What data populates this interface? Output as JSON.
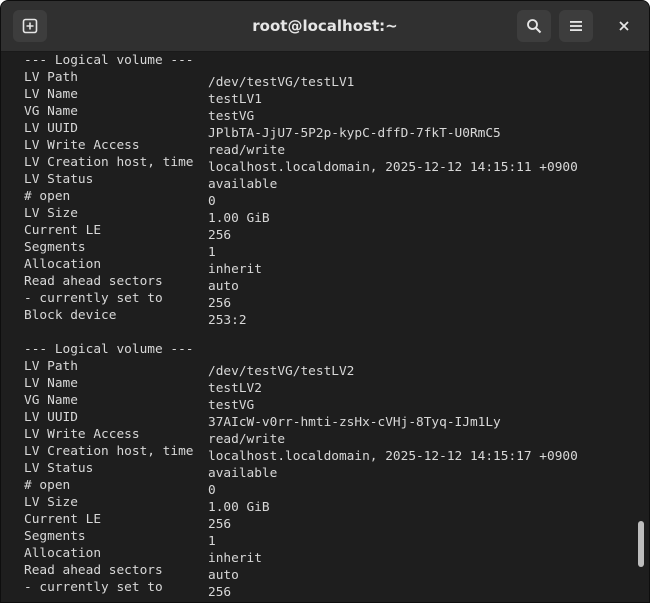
{
  "window": {
    "title": "root@localhost:~"
  },
  "icons": {
    "new_tab": "new-tab-icon",
    "search": "search-icon",
    "menu": "hamburger-menu-icon",
    "close": "close-icon"
  },
  "colors": {
    "terminal_bg": "#1e1e1e",
    "terminal_fg": "#d8d8d8",
    "headerbar_bg": "#303030"
  },
  "terminal": {
    "lines": [
      {
        "k": "",
        "v": "--- Logical volume ---"
      },
      {
        "k": "LV Path",
        "v": "/dev/testVG/testLV1"
      },
      {
        "k": "LV Name",
        "v": "testLV1"
      },
      {
        "k": "VG Name",
        "v": "testVG"
      },
      {
        "k": "LV UUID",
        "v": "JPlbTA-JjU7-5P2p-kypC-dffD-7fkT-U0RmC5"
      },
      {
        "k": "LV Write Access",
        "v": "read/write"
      },
      {
        "k": "LV Creation host, time",
        "v": "localhost.localdomain, 2025-12-12 14:15:11 +0900"
      },
      {
        "k": "LV Status",
        "v": "available"
      },
      {
        "k": "# open",
        "v": "0"
      },
      {
        "k": "LV Size",
        "v": "1.00 GiB"
      },
      {
        "k": "Current LE",
        "v": "256"
      },
      {
        "k": "Segments",
        "v": "1"
      },
      {
        "k": "Allocation",
        "v": "inherit"
      },
      {
        "k": "Read ahead sectors",
        "v": "auto"
      },
      {
        "k": "- currently set to",
        "v": "256"
      },
      {
        "k": "Block device",
        "v": "253:2"
      },
      {
        "k": "",
        "v": ""
      },
      {
        "k": "",
        "v": "--- Logical volume ---"
      },
      {
        "k": "LV Path",
        "v": "/dev/testVG/testLV2"
      },
      {
        "k": "LV Name",
        "v": "testLV2"
      },
      {
        "k": "VG Name",
        "v": "testVG"
      },
      {
        "k": "LV UUID",
        "v": "37AIcW-v0rr-hmti-zsHx-cVHj-8Tyq-IJm1Ly"
      },
      {
        "k": "LV Write Access",
        "v": "read/write"
      },
      {
        "k": "LV Creation host, time",
        "v": "localhost.localdomain, 2025-12-12 14:15:17 +0900"
      },
      {
        "k": "LV Status",
        "v": "available"
      },
      {
        "k": "# open",
        "v": "0"
      },
      {
        "k": "LV Size",
        "v": "1.00 GiB"
      },
      {
        "k": "Current LE",
        "v": "256"
      },
      {
        "k": "Segments",
        "v": "1"
      },
      {
        "k": "Allocation",
        "v": "inherit"
      },
      {
        "k": "Read ahead sectors",
        "v": "auto"
      },
      {
        "k": "- currently set to",
        "v": "256"
      }
    ]
  }
}
